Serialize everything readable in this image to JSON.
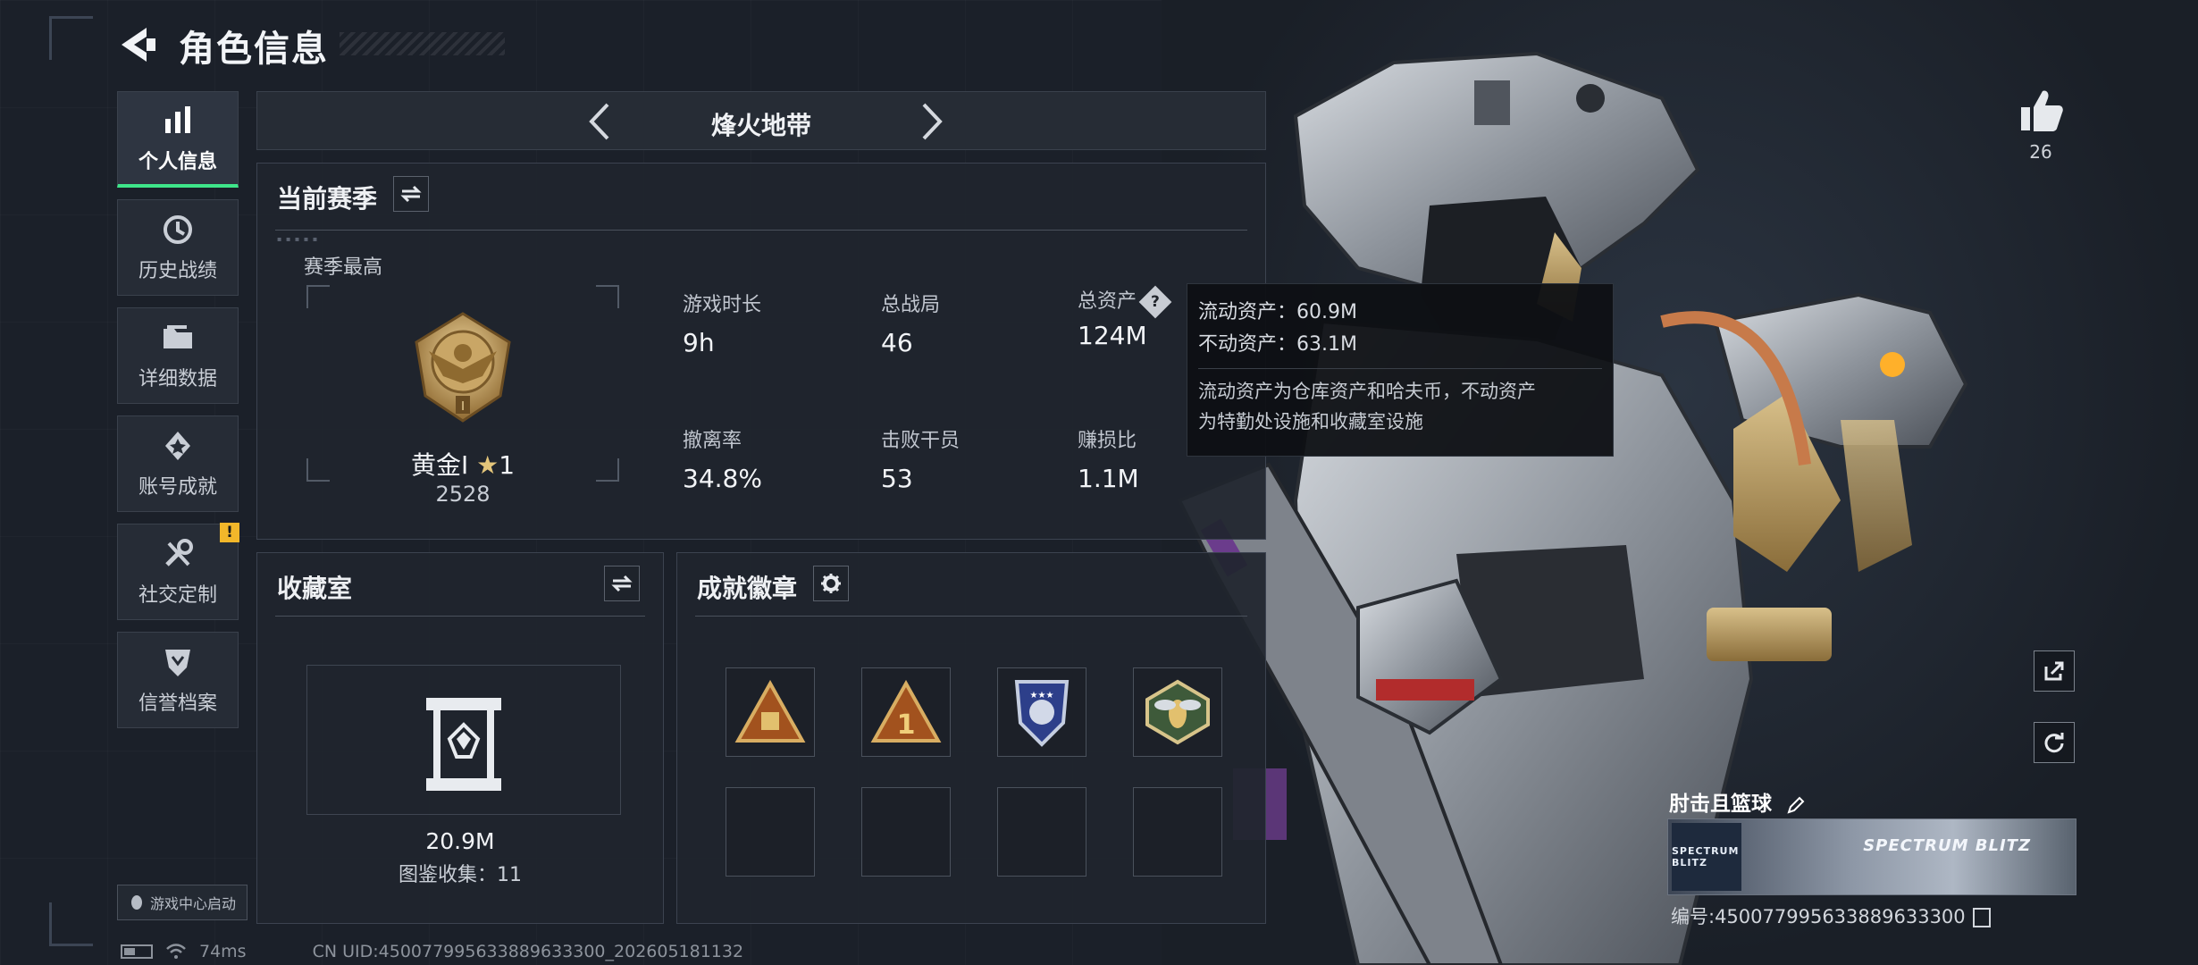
{
  "header": {
    "title": "角色信息"
  },
  "sidebar": {
    "items": [
      {
        "label": "个人信息",
        "icon": "bar-chart-icon"
      },
      {
        "label": "历史战绩",
        "icon": "history-icon"
      },
      {
        "label": "详细数据",
        "icon": "folder-icon"
      },
      {
        "label": "账号成就",
        "icon": "achievement-icon"
      },
      {
        "label": "社交定制",
        "icon": "tools-icon"
      },
      {
        "label": "信誉档案",
        "icon": "shield-icon"
      }
    ],
    "alert_badge": "!",
    "launch_label": "游戏中心启动"
  },
  "mode": {
    "title": "烽火地带"
  },
  "season": {
    "title": "当前赛季",
    "subtitle": "赛季最高",
    "rank_name": "黄金Ⅰ",
    "rank_star": "1",
    "rank_score": "2528",
    "stats": [
      {
        "label": "游戏时长",
        "value": "9h"
      },
      {
        "label": "总战局",
        "value": "46"
      },
      {
        "label": "总资产",
        "value": "124M"
      },
      {
        "label": "撤离率",
        "value": "34.8%"
      },
      {
        "label": "击败干员",
        "value": "53"
      },
      {
        "label": "赚损比",
        "value": "1.1M"
      }
    ]
  },
  "tooltip": {
    "liquid": "流动资产：60.9M",
    "fixed": "不动资产：63.1M",
    "desc_line1": "流动资产为仓库资产和哈夫币，不动资产",
    "desc_line2": "为特勤处设施和收藏室设施"
  },
  "vault": {
    "title": "收藏室",
    "value": "20.9M",
    "count": "图鉴收集：11"
  },
  "badges": {
    "title": "成就徽章"
  },
  "likes": {
    "count": "26"
  },
  "player": {
    "name": "肘击且篮球",
    "id": "编号:450077995633889633300",
    "banner_left": "SPECTRUM BLITZ",
    "banner_right": "SPECTRUM BLITZ"
  },
  "status": {
    "ping": "74ms",
    "uid": "CN UID:450077995633889633300_202605181132"
  },
  "colors": {
    "accent": "#3ee58a",
    "alert": "#f2b72a",
    "bg": "#1b2029",
    "tooltip_bg": "#0e1014"
  }
}
